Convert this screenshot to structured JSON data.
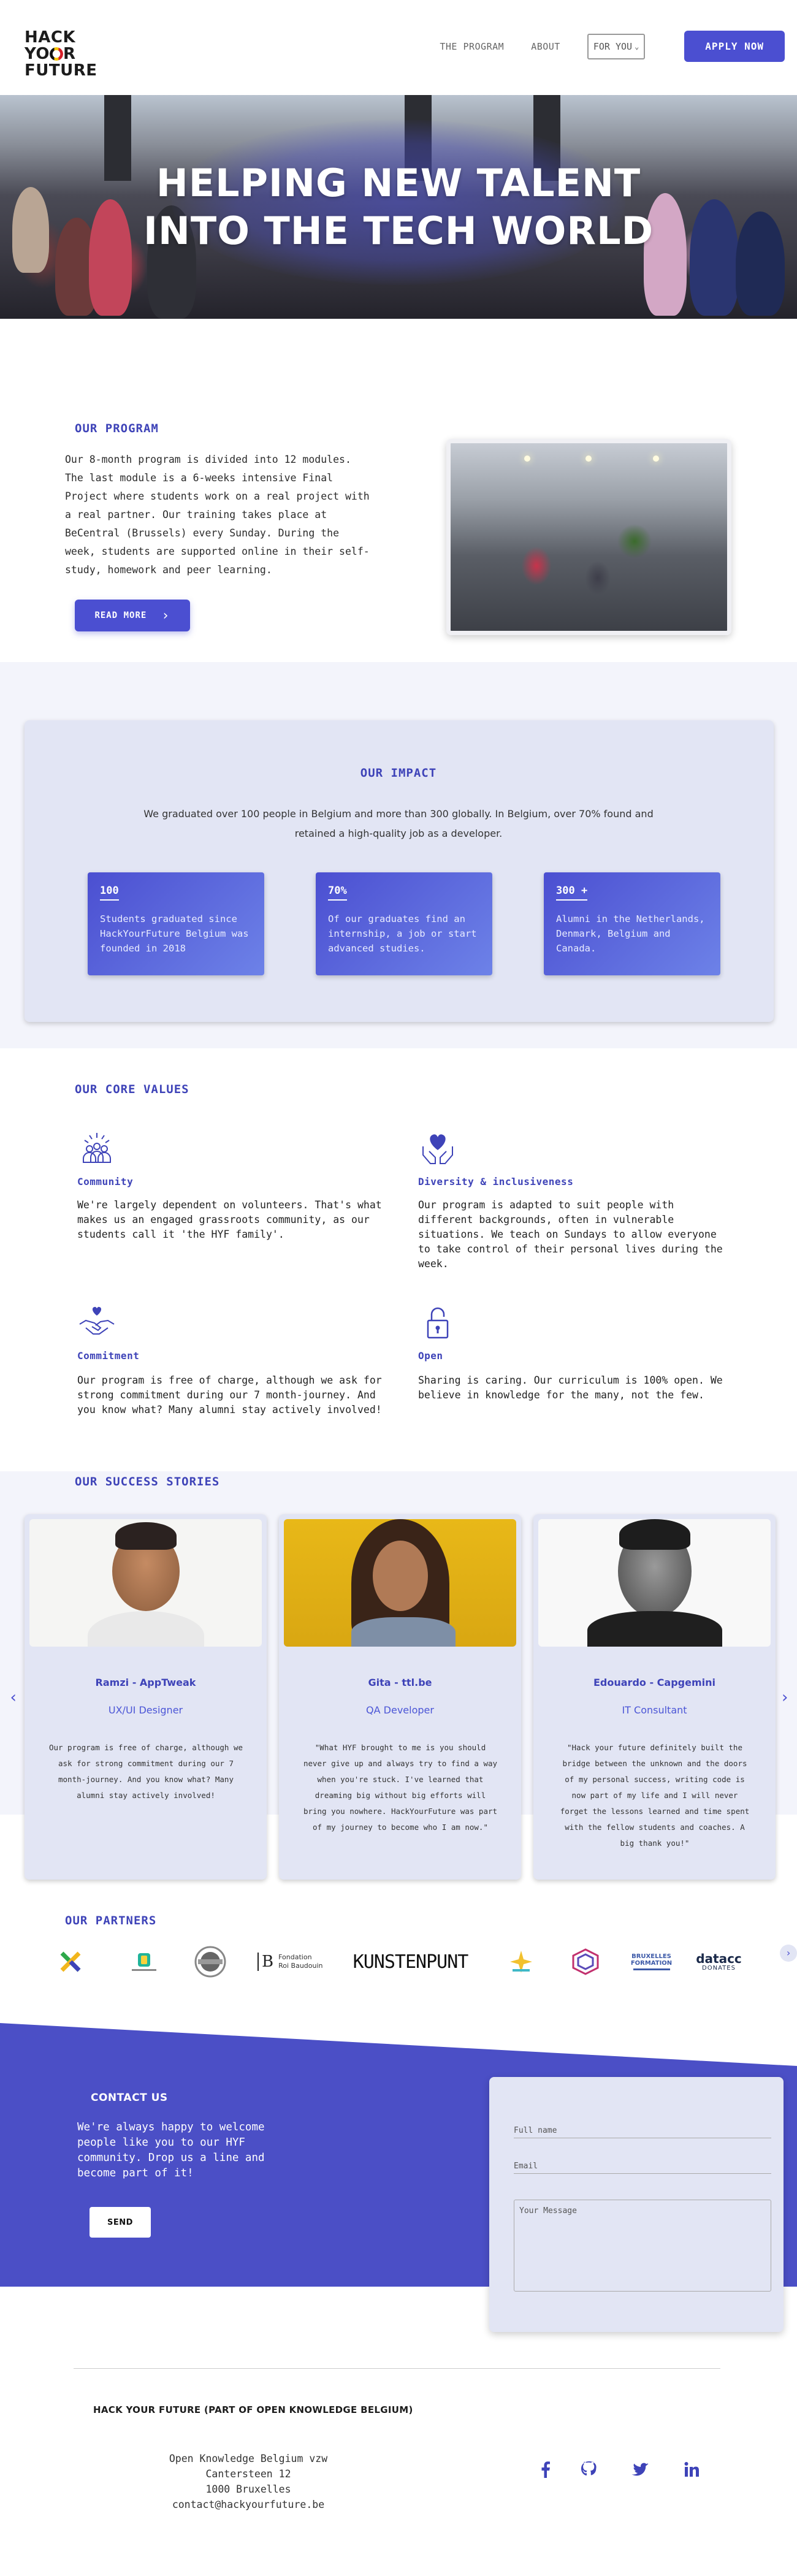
{
  "header": {
    "logo_line1": "HACK",
    "logo_line2_a": "YO",
    "logo_line2_b": "R",
    "logo_line3": "FUTURE",
    "nav": {
      "program": "THE PROGRAM",
      "about": "ABOUT",
      "for_you": "FOR YOU"
    },
    "apply": "APPLY NOW"
  },
  "hero": {
    "title_line1": "HELPING NEW TALENT",
    "title_line2": "INTO THE TECH WORLD"
  },
  "program": {
    "title": "OUR PROGRAM",
    "text": "Our 8-month program is divided into 12 modules. The last module is a 6-weeks intensive Final Project where students work on a real project with a real partner. Our training takes place at BeCentral (Brussels) every Sunday. During the week, students are supported online in their self-study, homework and peer learning.",
    "button": "READ MORE"
  },
  "impact": {
    "title": "OUR IMPACT",
    "description": "We graduated over 100 people in Belgium and more than 300 globally. In Belgium, over 70% found and retained a high-quality job as a developer.",
    "stats": [
      {
        "num": "100",
        "text": "Students graduated since HackYourFuture Belgium was founded in 2018"
      },
      {
        "num": "70%",
        "text": "Of our graduates find an internship, a job or start advanced studies."
      },
      {
        "num": "300 +",
        "text": "Alumni in the Netherlands, Denmark, Belgium and Canada."
      }
    ]
  },
  "values": {
    "title": "OUR CORE VALUES",
    "items": [
      {
        "title": "Community",
        "icon": "community-icon",
        "text": "We're largely dependent on volunteers. That's what makes us an engaged grassroots community, as our students call it 'the HYF family'."
      },
      {
        "title": "Diversity & inclusiveness",
        "icon": "heart-hands-icon",
        "text": "Our program is adapted to suit people with different backgrounds, often in vulnerable situations. We teach on Sundays to allow everyone to take control of their personal lives during the week."
      },
      {
        "title": "Commitment",
        "icon": "handshake-heart-icon",
        "text": "Our program is free of charge, although we ask for strong commitment during our 7 month-journey. And you know what? Many alumni stay actively involved!"
      },
      {
        "title": "Open",
        "icon": "open-lock-icon",
        "text": "Sharing is caring. Our curriculum is 100% open. We believe in knowledge for the many, not the few."
      }
    ]
  },
  "stories": {
    "title": "OUR SUCCESS STORIES",
    "items": [
      {
        "name": "Ramzi - AppTweak",
        "role": "UX/UI Designer",
        "quote": "Our program is free of charge, although we ask for strong commitment during our 7 month-journey. And you know what? Many alumni stay actively involved!"
      },
      {
        "name": "Gita - ttl.be",
        "role": "QA Developer",
        "quote": "\"What HYF brought to me is you should never give up and always try to find a way when you're stuck. I've learned that dreaming big without big efforts will bring you nowhere. HackYourFuture was part of my journey to become who I am now.\""
      },
      {
        "name": "Edouardo - Capgemini",
        "role": "IT Consultant",
        "quote": "\"Hack your future definitely built the bridge between the unknown and the doors of my personal success, writing code is now part of my life and I will never forget the lessons learned and time spent with the fellow students and coaches. A big thank you!\""
      }
    ]
  },
  "partners": {
    "title": "OUR PARTNERS",
    "logos": [
      {
        "name": "x-logo",
        "label": ""
      },
      {
        "name": "becode-logo",
        "label": ""
      },
      {
        "name": "badge-logo",
        "label": ""
      },
      {
        "name": "fondation-roi-baudouin-logo",
        "label_1": "Fondation",
        "label_2": "Roi Baudouin"
      },
      {
        "name": "kunstenpunt-logo",
        "label": "KUNSTENPUNT"
      },
      {
        "name": "sparkle-logo",
        "label": ""
      },
      {
        "name": "hexagon-logo",
        "label": ""
      },
      {
        "name": "bruxelles-formation-logo",
        "label_1": "BRUXELLES",
        "label_2": "FORMATION"
      },
      {
        "name": "datacc-logo",
        "label_1": "datacc",
        "label_2": "DONATES"
      }
    ]
  },
  "contact": {
    "title": "CONTACT US",
    "text": "We're always happy to welcome people like you to our HYF community. Drop us a line and become part of it!",
    "send": "SEND",
    "full_name": "Full name",
    "email": "Email",
    "message": "Your Message"
  },
  "footer": {
    "title": "HACK YOUR FUTURE (PART OF OPEN KNOWLEDGE BELGIUM)",
    "addr": [
      "Open Knowledge Belgium vzw",
      "Cantersteen 12",
      "1000 Bruxelles",
      "contact@hackyourfuture.be"
    ],
    "social": [
      "facebook-icon",
      "github-icon",
      "twitter-icon",
      "linkedin-icon"
    ]
  },
  "colors": {
    "brand": "#4b4fd1",
    "brand_dark": "#3e43b8",
    "card_bg": "#e2e5f4",
    "section_bg": "#f3f4fb"
  }
}
